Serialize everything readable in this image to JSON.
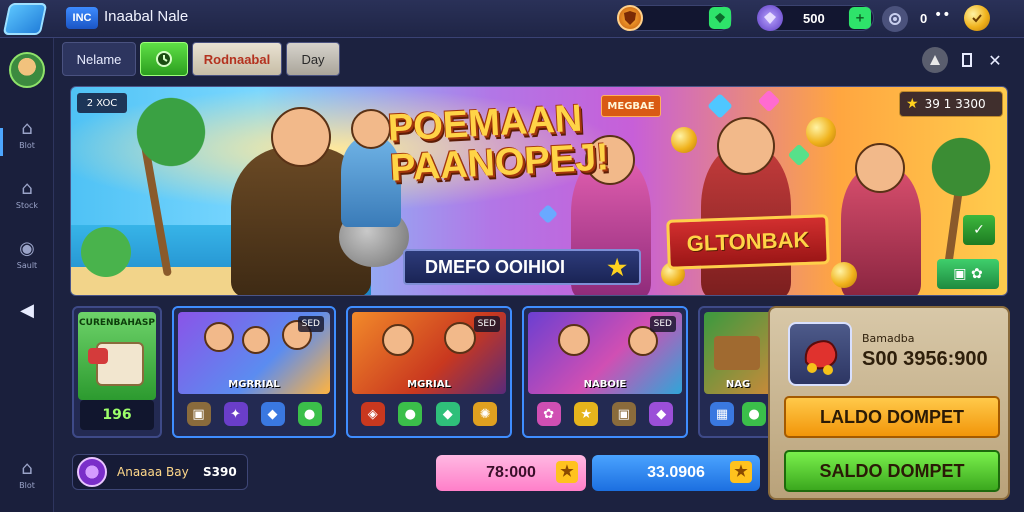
{
  "app": {
    "badge": "INC",
    "title": "Inaabal Nale"
  },
  "resources": [
    {
      "icon": "shield-icon",
      "value": "",
      "accent": "#2ee36a"
    },
    {
      "icon": "crystal-icon",
      "value": "500",
      "accent": "#2ee36a"
    },
    {
      "icon": "settings-icon",
      "value": "0"
    },
    {
      "icon": "coin-icon",
      "value": ""
    }
  ],
  "sidebar": {
    "items": [
      {
        "icon": "home-icon",
        "label": "Blot"
      },
      {
        "icon": "shop-icon",
        "label": "Stock"
      },
      {
        "icon": "settings-icon",
        "label": "Sault"
      },
      {
        "icon": "back-arrow-icon",
        "label": ""
      },
      {
        "icon": "home-icon",
        "label": "Blot"
      }
    ]
  },
  "tabs": [
    {
      "label": "Nelame",
      "active": false
    },
    {
      "label": "",
      "icon": "clock-icon",
      "active": true
    },
    {
      "label": "Rodnaabal",
      "active": false
    },
    {
      "label": "Day",
      "active": false
    }
  ],
  "banner": {
    "level": "2 XOC",
    "title_line1": "POEMAAN",
    "title_line2": "PAANOPEJ!",
    "promo": "DMEFO OOIHIOI",
    "event_tag": "MEGBAE",
    "ribbon": "GLTONBAK",
    "score": "39 1 3300"
  },
  "cards": [
    {
      "title": "CURENBAHASP",
      "price": "196",
      "type": "price"
    },
    {
      "tag": "SED",
      "name": "MGRRIAL",
      "type": "icons"
    },
    {
      "tag": "SED",
      "name": "MGRIAL",
      "type": "icons"
    },
    {
      "tag": "SED",
      "name": "NABOIE",
      "type": "icons"
    },
    {
      "tag": "",
      "name": "NAG",
      "type": "icons"
    }
  ],
  "popup": {
    "label": "Bamadba",
    "value": "S00 3956:900",
    "btn_primary": "LALDO DOMPET",
    "btn_secondary": "SALDO DOMPET"
  },
  "bottom": {
    "profile_name": "Anaaaa Bay",
    "profile_value": "S390",
    "pill_pink": "78:000",
    "pill_blue": "33.0906"
  },
  "colors": {
    "accent": "#3f8dff",
    "green": "#4fd02a",
    "gold": "#ffc21e",
    "pink": "#ff8fd4"
  }
}
